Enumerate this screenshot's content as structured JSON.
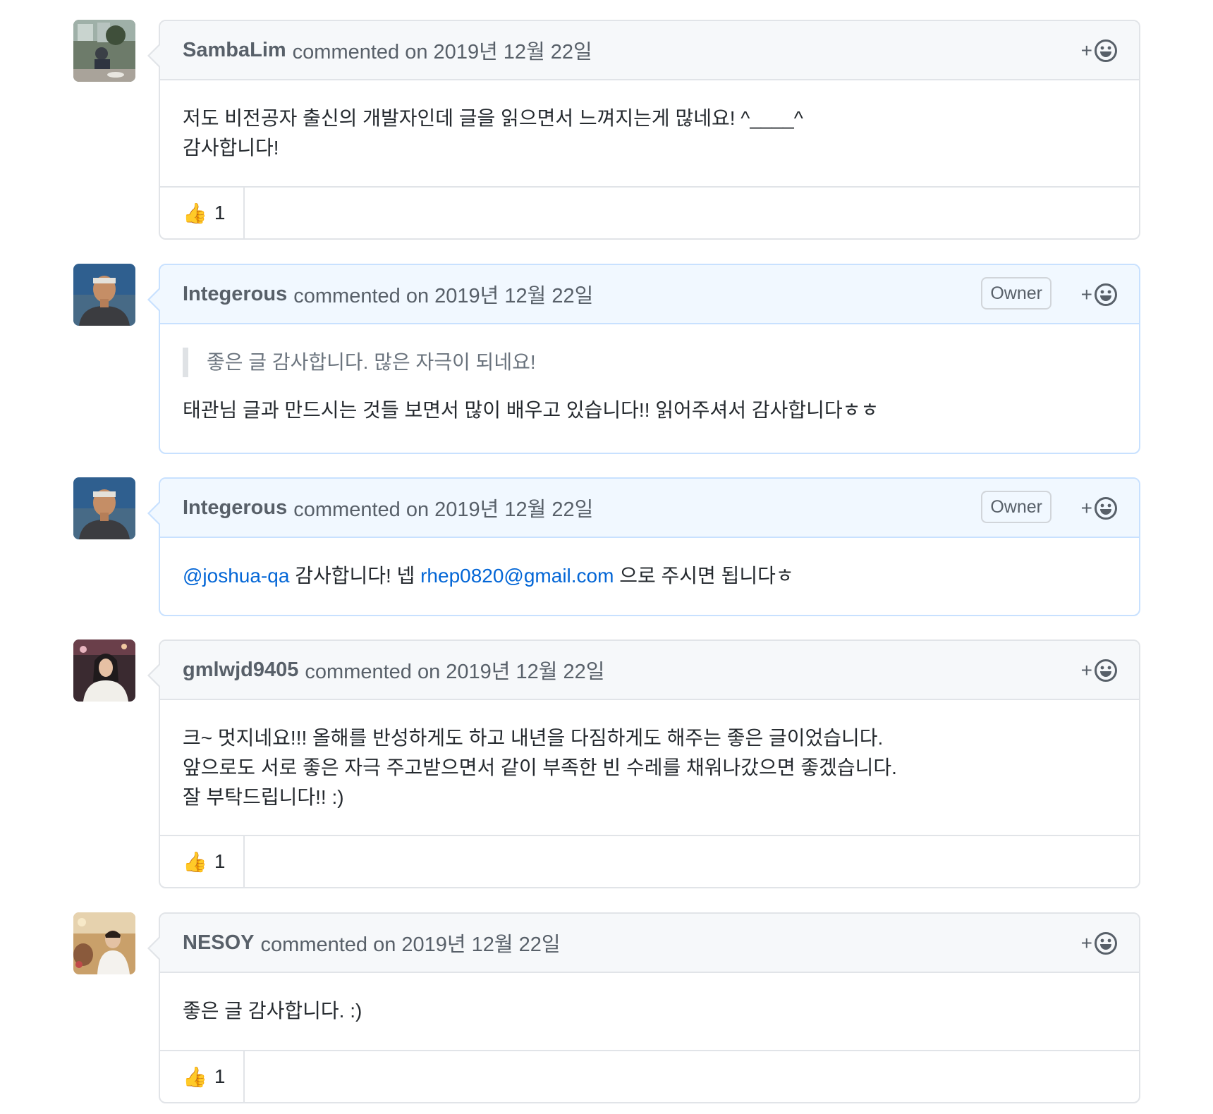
{
  "comments": [
    {
      "author": "SambaLim",
      "meta": "commented on 2019년 12월 22일",
      "badge": "",
      "lines": [
        "저도 비전공자 출신의 개발자인데 글을 읽으면서 느껴지는게 많네요! ^____^",
        "감사합니다!"
      ],
      "reaction": {
        "emoji": "👍",
        "count": "1"
      }
    },
    {
      "author": "Integerous",
      "meta": "commented on 2019년 12월 22일",
      "badge": "Owner",
      "quote": "좋은 글 감사합니다. 많은 자극이 되네요!",
      "lines": [
        "태관님 글과 만드시는 것들 보면서 많이 배우고 있습니다!! 읽어주셔서 감사합니다ㅎㅎ"
      ]
    },
    {
      "author": "Integerous",
      "meta": "commented on 2019년 12월 22일",
      "badge": "Owner",
      "mention": "@joshua-qa",
      "text_a": "감사합니다! 넵",
      "email": "rhep0820@gmail.com",
      "text_b": "으로 주시면 됩니다ㅎ"
    },
    {
      "author": "gmlwjd9405",
      "meta": "commented on 2019년 12월 22일",
      "badge": "",
      "lines": [
        "크~ 멋지네요!!! 올해를 반성하게도 하고 내년을 다짐하게도 해주는 좋은 글이었습니다.",
        "앞으로도 서로 좋은 자극 주고받으면서 같이 부족한 빈 수레를 채워나갔으면 좋겠습니다.",
        "잘 부탁드립니다!! :)"
      ],
      "reaction": {
        "emoji": "👍",
        "count": "1"
      }
    },
    {
      "author": "NESOY",
      "meta": "commented on 2019년 12월 22일",
      "badge": "",
      "lines": [
        "좋은 글 감사합니다. :)"
      ],
      "reaction": {
        "emoji": "👍",
        "count": "1"
      }
    }
  ],
  "reaction_button": {
    "plus": "+",
    "icon": "smiley-icon"
  }
}
